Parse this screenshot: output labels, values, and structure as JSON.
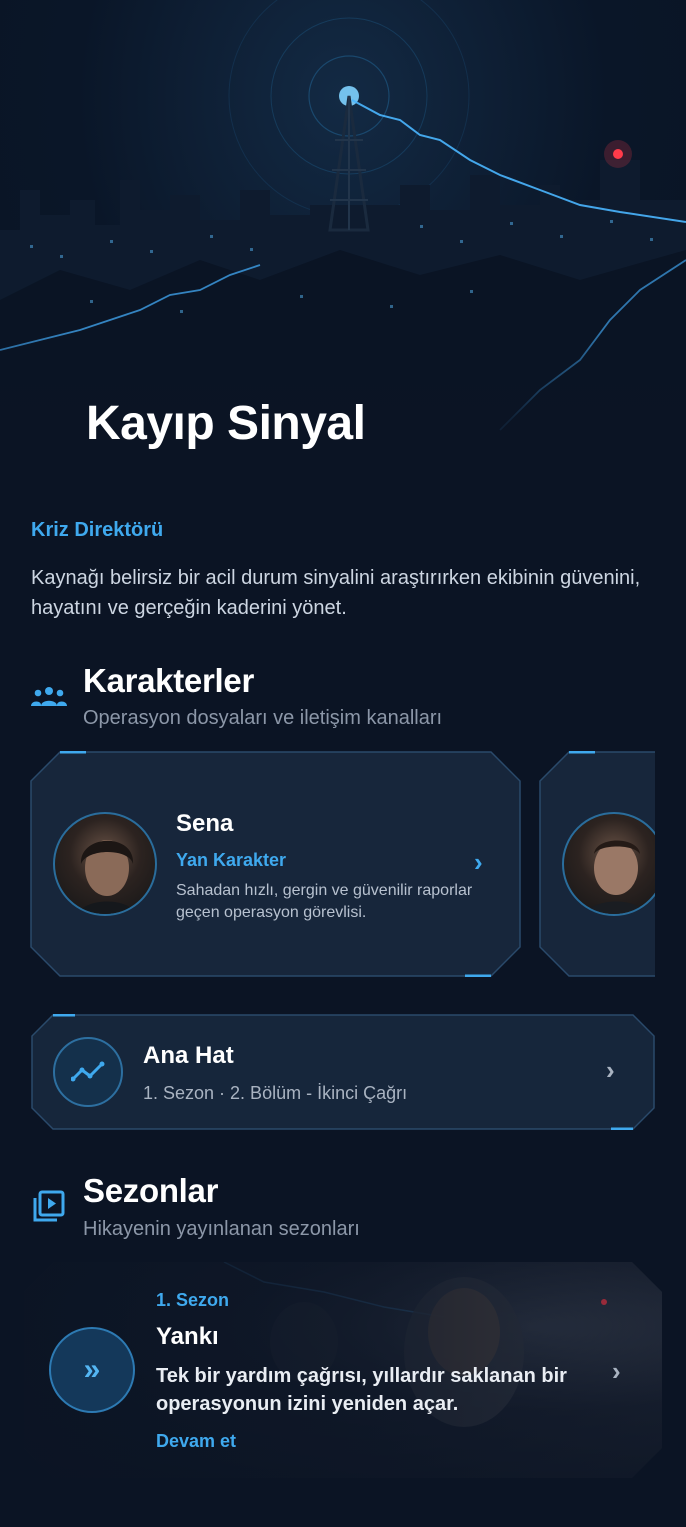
{
  "hero": {
    "title": "Kayıp Sinyal"
  },
  "intro": {
    "subtitle": "Kriz Direktörü",
    "description": "Kaynağı belirsiz bir acil durum sinyalini araştırırken ekibinin güvenini, hayatını ve gerçeğin kaderini yönet."
  },
  "characters_section": {
    "icon": "group-icon",
    "title": "Karakterler",
    "subtitle": "Operasyon dosyaları ve iletişim kanalları",
    "cards": [
      {
        "name": "Sena",
        "role": "Yan Karakter",
        "description": "Sahadan hızlı, gergin ve güvenilir raporlar geçen operasyon görevlisi."
      }
    ]
  },
  "main_line": {
    "icon": "trend-line-icon",
    "title": "Ana Hat",
    "subtitle": "1. Sezon · 2. Bölüm - İkinci Çağrı"
  },
  "seasons_section": {
    "icon": "playlist-play-icon",
    "title": "Sezonlar",
    "subtitle": "Hikayenin yayınlanan sezonları",
    "season": {
      "kicker": "1. Sezon",
      "title": "Yankı",
      "description": "Tek bir yardım çağrısı, yıllardır saklanan bir operasyonun izini yeniden açar.",
      "cta": "Devam et"
    }
  },
  "colors": {
    "accent": "#3fa9ee",
    "background": "#0b1424",
    "card": "#17263d"
  }
}
